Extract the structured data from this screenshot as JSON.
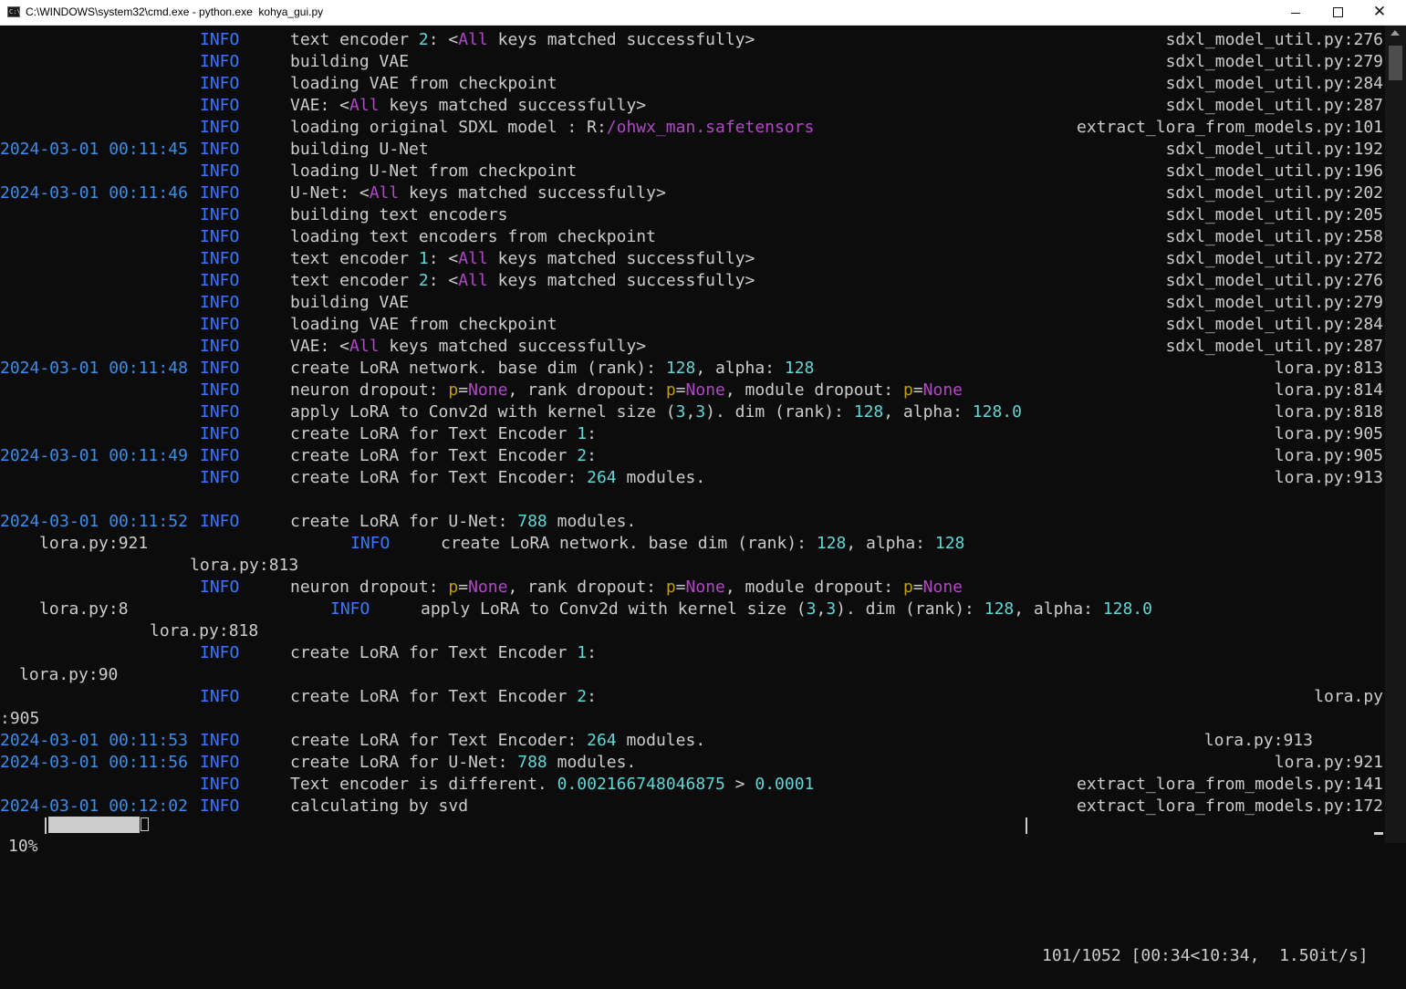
{
  "window": {
    "title": "C:\\WINDOWS\\system32\\cmd.exe - python.exe  kohya_gui.py",
    "icon": "cmd-icon",
    "icon_text": "C:\\",
    "minimize": "minimize-icon",
    "maximize": "maximize-icon",
    "close": "close-icon",
    "close_glyph": "✕"
  },
  "colors": {
    "background": "#0c0c0c",
    "text": "#cccccc",
    "timestamp": "#3b8eea",
    "level": "#3b78ff",
    "number": "#61d6d6",
    "keyword": "#b148c6",
    "prefix": "#c19c00"
  },
  "lines": [
    {
      "ts": "",
      "lvl": "INFO",
      "msg": [
        [
          "text encoder ",
          ""
        ],
        [
          "2",
          "n"
        ],
        [
          ": <",
          ""
        ],
        [
          "All",
          "m"
        ],
        [
          " keys matched successfully>",
          ""
        ]
      ],
      "src": "sdxl_model_util.py:276"
    },
    {
      "ts": "",
      "lvl": "INFO",
      "msg": [
        [
          "building VAE",
          ""
        ]
      ],
      "src": "sdxl_model_util.py:279"
    },
    {
      "ts": "",
      "lvl": "INFO",
      "msg": [
        [
          "loading VAE from checkpoint",
          ""
        ]
      ],
      "src": "sdxl_model_util.py:284"
    },
    {
      "ts": "",
      "lvl": "INFO",
      "msg": [
        [
          "VAE: <",
          ""
        ],
        [
          "All",
          "m"
        ],
        [
          " keys matched successfully>",
          ""
        ]
      ],
      "src": "sdxl_model_util.py:287"
    },
    {
      "ts": "",
      "lvl": "INFO",
      "msg": [
        [
          "loading original SDXL model : R:",
          ""
        ],
        [
          "/ohwx_man.safetensors",
          "m"
        ]
      ],
      "src": "extract_lora_from_models.py:101"
    },
    {
      "ts": "2024-03-01 00:11:45",
      "lvl": "INFO",
      "msg": [
        [
          "building U-Net",
          ""
        ]
      ],
      "src": "sdxl_model_util.py:192"
    },
    {
      "ts": "",
      "lvl": "INFO",
      "msg": [
        [
          "loading U-Net from checkpoint",
          ""
        ]
      ],
      "src": "sdxl_model_util.py:196"
    },
    {
      "ts": "2024-03-01 00:11:46",
      "lvl": "INFO",
      "msg": [
        [
          "U-Net: <",
          ""
        ],
        [
          "All",
          "m"
        ],
        [
          " keys matched successfully>",
          ""
        ]
      ],
      "src": "sdxl_model_util.py:202"
    },
    {
      "ts": "",
      "lvl": "INFO",
      "msg": [
        [
          "building text encoders",
          ""
        ]
      ],
      "src": "sdxl_model_util.py:205"
    },
    {
      "ts": "",
      "lvl": "INFO",
      "msg": [
        [
          "loading text encoders from checkpoint",
          ""
        ]
      ],
      "src": "sdxl_model_util.py:258"
    },
    {
      "ts": "",
      "lvl": "INFO",
      "msg": [
        [
          "text encoder ",
          ""
        ],
        [
          "1",
          "n"
        ],
        [
          ": <",
          ""
        ],
        [
          "All",
          "m"
        ],
        [
          " keys matched successfully>",
          ""
        ]
      ],
      "src": "sdxl_model_util.py:272"
    },
    {
      "ts": "",
      "lvl": "INFO",
      "msg": [
        [
          "text encoder ",
          ""
        ],
        [
          "2",
          "n"
        ],
        [
          ": <",
          ""
        ],
        [
          "All",
          "m"
        ],
        [
          " keys matched successfully>",
          ""
        ]
      ],
      "src": "sdxl_model_util.py:276"
    },
    {
      "ts": "",
      "lvl": "INFO",
      "msg": [
        [
          "building VAE",
          ""
        ]
      ],
      "src": "sdxl_model_util.py:279"
    },
    {
      "ts": "",
      "lvl": "INFO",
      "msg": [
        [
          "loading VAE from checkpoint",
          ""
        ]
      ],
      "src": "sdxl_model_util.py:284"
    },
    {
      "ts": "",
      "lvl": "INFO",
      "msg": [
        [
          "VAE: <",
          ""
        ],
        [
          "All",
          "m"
        ],
        [
          " keys matched successfully>",
          ""
        ]
      ],
      "src": "sdxl_model_util.py:287"
    },
    {
      "ts": "2024-03-01 00:11:48",
      "lvl": "INFO",
      "msg": [
        [
          "create LoRA network. base dim (rank): ",
          ""
        ],
        [
          "128",
          "n"
        ],
        [
          ", alpha: ",
          ""
        ],
        [
          "128",
          "n"
        ]
      ],
      "src": "lora.py:813"
    },
    {
      "ts": "",
      "lvl": "INFO",
      "msg": [
        [
          "neuron dropout: ",
          ""
        ],
        [
          "p",
          "y"
        ],
        [
          "=",
          ""
        ],
        [
          "None",
          "m"
        ],
        [
          ", rank dropout: ",
          ""
        ],
        [
          "p",
          "y"
        ],
        [
          "=",
          ""
        ],
        [
          "None",
          "m"
        ],
        [
          ", module dropout: ",
          ""
        ],
        [
          "p",
          "y"
        ],
        [
          "=",
          ""
        ],
        [
          "None",
          "m"
        ]
      ],
      "src": "lora.py:814"
    },
    {
      "ts": "",
      "lvl": "INFO",
      "msg": [
        [
          "apply LoRA to Conv2d with kernel size (",
          ""
        ],
        [
          "3",
          "n"
        ],
        [
          ",",
          ""
        ],
        [
          "3",
          "n"
        ],
        [
          "). dim (rank): ",
          ""
        ],
        [
          "128",
          "n"
        ],
        [
          ", alpha: ",
          ""
        ],
        [
          "128.0",
          "n"
        ]
      ],
      "src": "lora.py:818"
    },
    {
      "ts": "",
      "lvl": "INFO",
      "msg": [
        [
          "create LoRA for Text Encoder ",
          ""
        ],
        [
          "1",
          "n"
        ],
        [
          ":",
          ""
        ]
      ],
      "src": "lora.py:905"
    },
    {
      "ts": "2024-03-01 00:11:49",
      "lvl": "INFO",
      "msg": [
        [
          "create LoRA for Text Encoder ",
          ""
        ],
        [
          "2",
          "n"
        ],
        [
          ":",
          ""
        ]
      ],
      "src": "lora.py:905"
    },
    {
      "ts": "",
      "lvl": "INFO",
      "msg": [
        [
          "create LoRA for Text Encoder: ",
          ""
        ],
        [
          "264",
          "n"
        ],
        [
          " modules.",
          ""
        ]
      ],
      "src": "lora.py:913"
    },
    {
      "ts": "",
      "lvl": "",
      "msg": [],
      "src": ""
    },
    {
      "ts": "2024-03-01 00:11:52",
      "lvl": "INFO",
      "msg": [
        [
          "create LoRA for U-Net: ",
          ""
        ],
        [
          "788",
          "n"
        ],
        [
          " modules.",
          ""
        ]
      ],
      "src": ""
    }
  ],
  "wrapped": {
    "l23_src": "lora.py:921",
    "l23_lvl": "INFO",
    "l23_msg": [
      [
        "create LoRA network. base dim (rank): ",
        ""
      ],
      [
        "128",
        "n"
      ],
      [
        ", alpha: ",
        ""
      ],
      [
        "128",
        "n"
      ]
    ],
    "l24_src": "lora.py:813",
    "l25_lvl": "INFO",
    "l25_msg": [
      [
        "neuron dropout: ",
        ""
      ],
      [
        "p",
        "y"
      ],
      [
        "=",
        ""
      ],
      [
        "None",
        "m"
      ],
      [
        ", rank dropout: ",
        ""
      ],
      [
        "p",
        "y"
      ],
      [
        "=",
        ""
      ],
      [
        "None",
        "m"
      ],
      [
        ", module dropout: ",
        ""
      ],
      [
        "p",
        "y"
      ],
      [
        "=",
        ""
      ],
      [
        "None",
        "m"
      ]
    ],
    "l26_src": "lora.py:8",
    "l26_lvl": "INFO",
    "l26_msg": [
      [
        "apply LoRA to Conv2d with kernel size (",
        ""
      ],
      [
        "3",
        "n"
      ],
      [
        ",",
        ""
      ],
      [
        "3",
        "n"
      ],
      [
        "). dim (rank): ",
        ""
      ],
      [
        "128",
        "n"
      ],
      [
        ", alpha: ",
        ""
      ],
      [
        "128.0",
        "n"
      ]
    ],
    "l27_src": "lora.py:818",
    "l28_lvl": "INFO",
    "l28_msg": [
      [
        "create LoRA for Text Encoder ",
        ""
      ],
      [
        "1",
        "n"
      ],
      [
        ":",
        ""
      ]
    ],
    "l29_src": "lora.py:90",
    "l30_lvl": "INFO",
    "l30_msg": [
      [
        "create LoRA for Text Encoder ",
        ""
      ],
      [
        "2",
        "n"
      ],
      [
        ":",
        ""
      ]
    ],
    "l30_src": "lora.py",
    "l31_src": ":905"
  },
  "tail": [
    {
      "ts": "2024-03-01 00:11:53",
      "lvl": "INFO",
      "msg": [
        [
          "create LoRA for Text Encoder: ",
          ""
        ],
        [
          "264",
          "n"
        ],
        [
          " modules.",
          ""
        ]
      ],
      "src": "lora.py:913",
      "src_shift": true
    },
    {
      "ts": "2024-03-01 00:11:56",
      "lvl": "INFO",
      "msg": [
        [
          "create LoRA for U-Net: ",
          ""
        ],
        [
          "788",
          "n"
        ],
        [
          " modules.",
          ""
        ]
      ],
      "src": "lora.py:921"
    },
    {
      "ts": "",
      "lvl": "INFO",
      "msg": [
        [
          "Text encoder is different. ",
          ""
        ],
        [
          "0.002166748046875",
          "n"
        ],
        [
          " > ",
          ""
        ],
        [
          "0.0001",
          "n"
        ]
      ],
      "src": "extract_lora_from_models.py:141"
    },
    {
      "ts": "2024-03-01 00:12:02",
      "lvl": "INFO",
      "msg": [
        [
          "calculating by svd",
          ""
        ]
      ],
      "src": "extract_lora_from_models.py:172"
    }
  ],
  "progress": {
    "percent": "10%",
    "fraction": 0.1,
    "end_glyph": "?",
    "stats": "101/1052 [00:34<10:34,  1.50it/s]"
  }
}
